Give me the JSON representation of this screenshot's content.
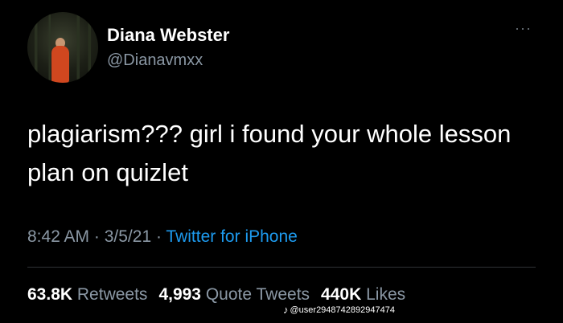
{
  "user": {
    "display_name": "Diana Webster",
    "handle": "@Dianavmxx",
    "more_icon": "more-horizontal-icon"
  },
  "tweet": {
    "text": "plagiarism??? girl i found your whole lesson plan on quizlet",
    "time": "8:42 AM",
    "separator": " · ",
    "date": "3/5/21",
    "source": "Twitter for iPhone"
  },
  "stats": {
    "retweets_count": "63.8K",
    "retweets_label": "Retweets",
    "quotes_count": "4,993",
    "quotes_label": "Quote Tweets",
    "likes_count": "440K",
    "likes_label": "Likes"
  },
  "watermark": {
    "icon": "tiktok-icon",
    "text": "@user2948742892947474"
  },
  "colors": {
    "background": "#000000",
    "secondary_text": "#8b98a5",
    "link": "#1d9bf0"
  }
}
